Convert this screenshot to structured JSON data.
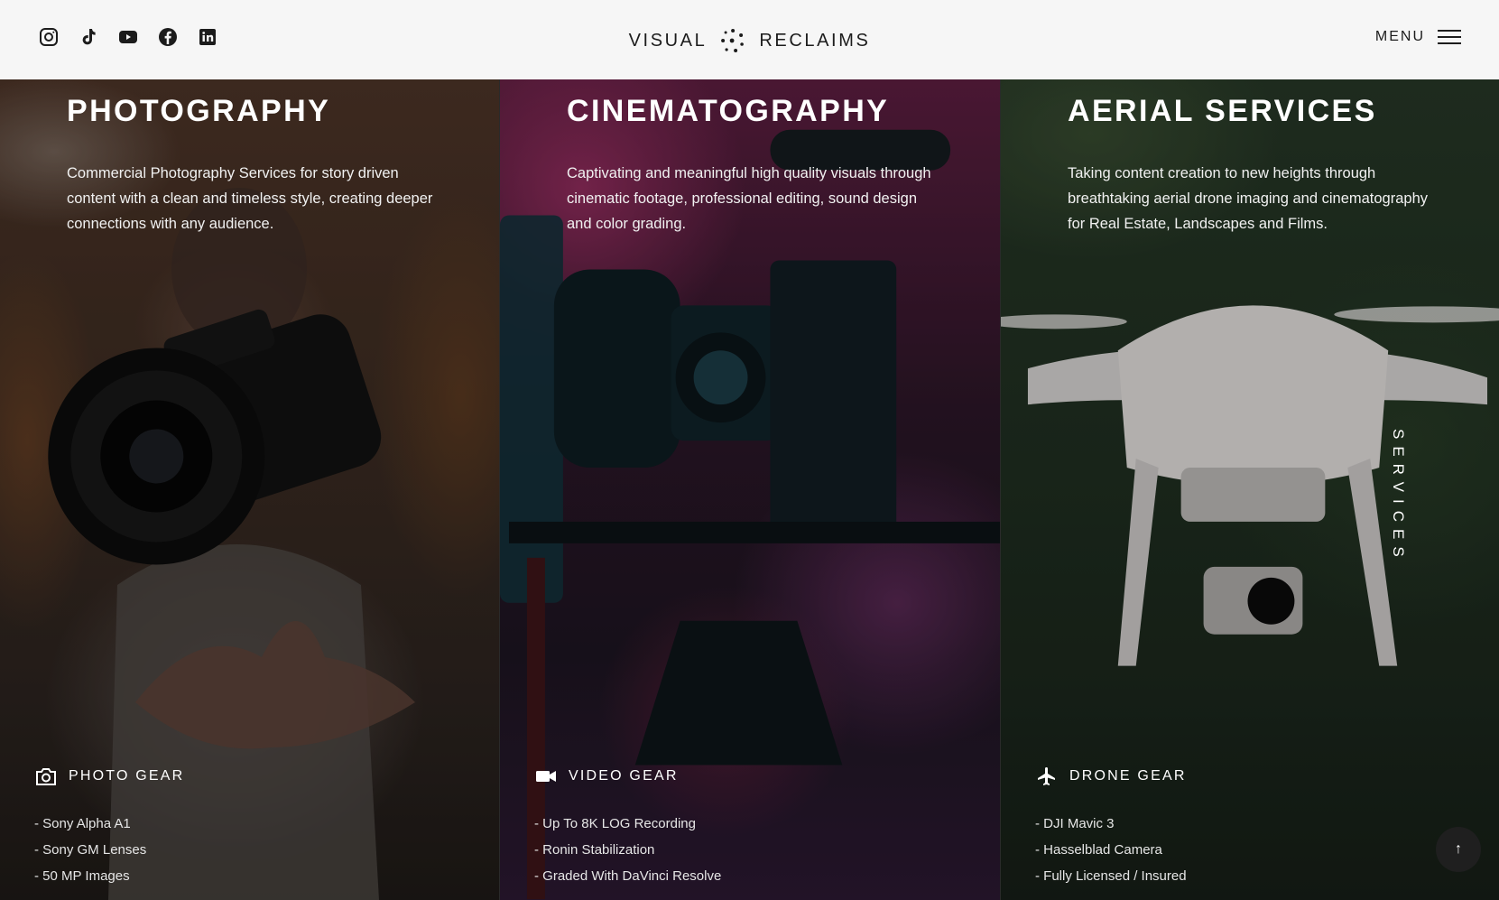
{
  "header": {
    "logo_left": "VISUAL",
    "logo_right": "RECLAIMS",
    "menu_label": "MENU",
    "social": [
      "instagram-icon",
      "tiktok-icon",
      "youtube-icon",
      "facebook-icon",
      "linkedin-icon"
    ]
  },
  "panels": [
    {
      "title": "PHOTOGRAPHY",
      "description": "Commercial Photography Services for story driven content with a clean and timeless style, creating deeper connections with any audience.",
      "gear_title": "PHOTO GEAR",
      "gear_icon": "camera-icon",
      "gear_items": [
        "- Sony Alpha A1",
        "- Sony GM Lenses",
        "- 50 MP Images"
      ]
    },
    {
      "title": "CINEMATOGRAPHY",
      "description": "Captivating and meaningful high quality visuals through cinematic footage, professional editing, sound design and color grading.",
      "gear_title": "VIDEO GEAR",
      "gear_icon": "video-camera-icon",
      "gear_items": [
        "- Up To 8K LOG Recording",
        "- Ronin Stabilization",
        "- Graded With DaVinci Resolve"
      ]
    },
    {
      "title": "AERIAL SERVICES",
      "description": "Taking content creation to new heights through breathtaking aerial drone imaging and cinematography for Real Estate, Landscapes and Films.",
      "gear_title": "DRONE GEAR",
      "gear_icon": "airplane-icon",
      "gear_items": [
        "- DJI Mavic 3",
        "- Hasselblad Camera",
        "- Fully Licensed / Insured"
      ]
    }
  ],
  "side_label": "SERVICES",
  "scroll_top_label": "↑",
  "colors": {
    "header_bg": "#f6f6f6",
    "header_text": "#1c1c1c",
    "text": "#ffffff"
  }
}
